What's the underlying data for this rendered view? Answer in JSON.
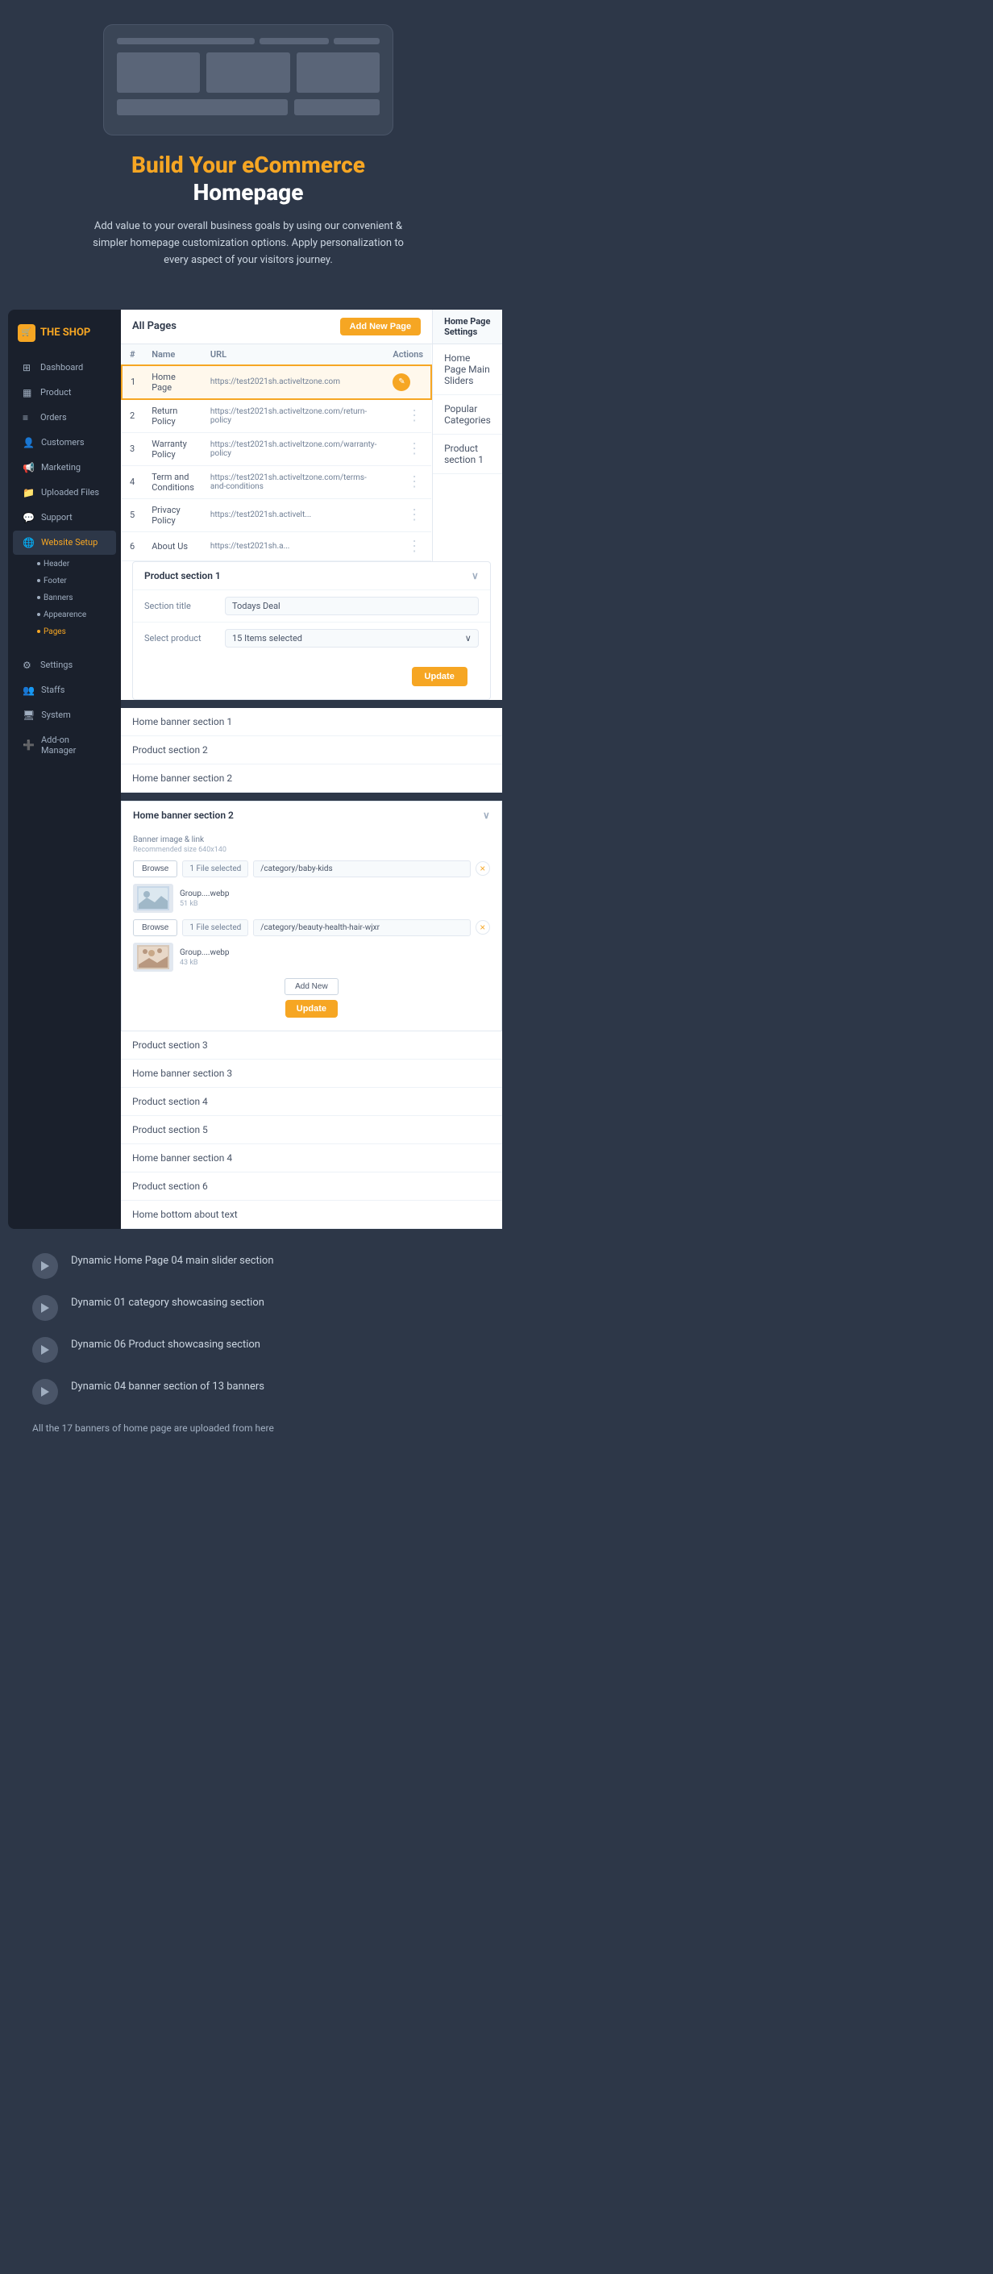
{
  "hero": {
    "title_orange": "Build Your eCommerce",
    "title_white": "Homepage",
    "description": "Add value to your overall business goals by using our convenient & simpler homepage customization options. Apply personalization to every aspect of your visitors journey."
  },
  "sidebar": {
    "logo": "THE SHOP",
    "items": [
      {
        "label": "Dashboard",
        "icon": "⊞",
        "active": false
      },
      {
        "label": "Product",
        "icon": "▦",
        "active": false
      },
      {
        "label": "Orders",
        "icon": "≡",
        "active": false
      },
      {
        "label": "Customers",
        "icon": "👤",
        "active": false
      },
      {
        "label": "Marketing",
        "icon": "📢",
        "active": false
      },
      {
        "label": "Uploaded Files",
        "icon": "📁",
        "active": false
      },
      {
        "label": "Support",
        "icon": "💬",
        "active": false
      },
      {
        "label": "Website Setup",
        "icon": "🌐",
        "active": true
      }
    ],
    "sub_items": [
      {
        "label": "Header",
        "active": false
      },
      {
        "label": "Footer",
        "active": false
      },
      {
        "label": "Banners",
        "active": false
      },
      {
        "label": "Appearence",
        "active": false
      },
      {
        "label": "Pages",
        "active": true
      }
    ],
    "bottom_items": [
      {
        "label": "Settings",
        "icon": "⚙"
      },
      {
        "label": "Staffs",
        "icon": "👥"
      },
      {
        "label": "System",
        "icon": "🖥"
      },
      {
        "label": "Add-on Manager",
        "icon": "➕"
      }
    ]
  },
  "pages": {
    "title": "All Pages",
    "add_button": "Add New Page",
    "columns": [
      "#",
      "Name",
      "URL",
      "Actions"
    ],
    "rows": [
      {
        "num": "1",
        "name": "Home Page",
        "url": "https://test2021sh.activeltzone.com",
        "highlighted": true
      },
      {
        "num": "2",
        "name": "Return Policy",
        "url": "https://test2021sh.activeltzone.com/return-policy"
      },
      {
        "num": "3",
        "name": "Warranty Policy",
        "url": "https://test2021sh.activeltzone.com/warranty-policy"
      },
      {
        "num": "4",
        "name": "Term and Conditions",
        "url": "https://test2021sh.activeltzone.com/terms-and-conditions"
      },
      {
        "num": "5",
        "name": "Privacy Policy",
        "url": "https://test2021sh.activelt..."
      },
      {
        "num": "6",
        "name": "About Us",
        "url": "https://test2021sh.a..."
      }
    ]
  },
  "settings": {
    "header": "Home Page Settings",
    "items": [
      "Home Page Main Sliders",
      "Popular Categories",
      "Product section 1"
    ]
  },
  "product_section1": {
    "title": "Product section 1",
    "section_title_label": "Section title",
    "section_title_value": "Todays Deal",
    "select_product_label": "Select product",
    "select_product_value": "15 Items selected",
    "update_btn": "Update"
  },
  "more_sections": [
    "Home banner section 1",
    "Product section 2",
    "Home banner section 2"
  ],
  "banner_section2": {
    "title": "Home banner section 2",
    "field_label": "Banner image & link",
    "field_sublabel": "Recommended size 640x140",
    "banners": [
      {
        "file_selected": "1 File selected",
        "path": "/category/baby-kids",
        "thumb_label": "Group....webp",
        "thumb_size": "51 kB"
      },
      {
        "file_selected": "1 File selected",
        "path": "/category/beauty-health-hair-wjxr",
        "thumb_label": "Group....webp",
        "thumb_size": "43 kB"
      }
    ],
    "add_new_btn": "Add New",
    "update_btn": "Update"
  },
  "more_sections2": [
    "Product section 3",
    "Home banner section 3",
    "Product section 4",
    "Product section 5",
    "Home banner section 4",
    "Product section 6",
    "Home bottom about text"
  ],
  "features": {
    "items": [
      {
        "title": "Dynamic Home Page 04 main slider section"
      },
      {
        "title": "Dynamic 01 category showcasing section"
      },
      {
        "title": "Dynamic 06 Product showcasing section"
      },
      {
        "title": "Dynamic 04 banner section of 13 banners"
      }
    ],
    "note": "All the 17 banners of home page are uploaded from here"
  }
}
